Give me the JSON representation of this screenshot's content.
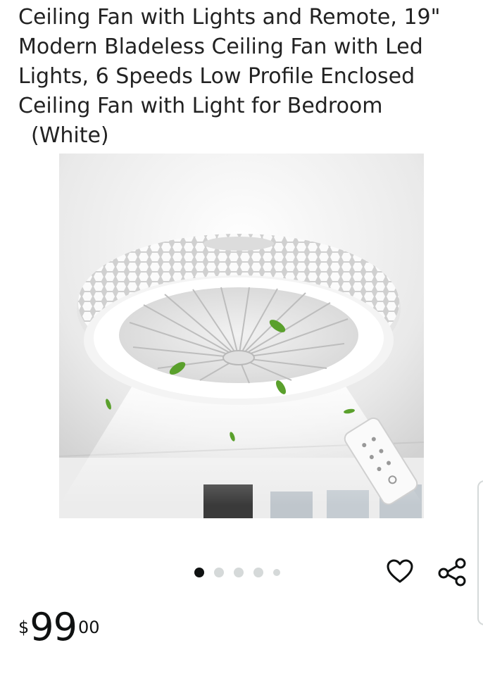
{
  "product": {
    "title_lines": [
      "Ceiling Fan with Lights and Remote, 19\"",
      "Modern Bladeless Ceiling Fan with Led",
      "Lights, 6 Speeds Low Profile Enclosed",
      "Ceiling Fan with Light for Bedroom",
      "(White)"
    ]
  },
  "gallery": {
    "dot_count": 5,
    "active_dot_index": 0
  },
  "actions": {
    "wishlist_icon": "heart-outline-icon",
    "share_icon": "share-icon"
  },
  "price": {
    "symbol": "$",
    "whole": "99",
    "fraction": "00"
  },
  "colors": {
    "text": "#0f1111",
    "dot_inactive": "#d5d9d9",
    "leaf_green": "#5aa02c"
  }
}
